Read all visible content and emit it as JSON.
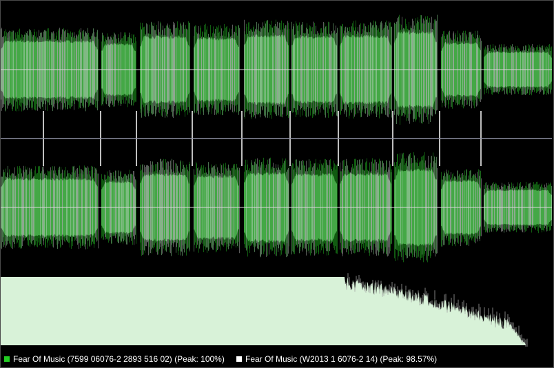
{
  "legend": [
    {
      "label": "Fear Of Music (7599 06076-2 2893 516 02) (Peak: 100%)",
      "color": "#22cc22"
    },
    {
      "label": "Fear Of Music (W2013 1 6076-2 14) (Peak: 98.57%)",
      "color": "#ffffff"
    }
  ],
  "tracks": [
    {
      "amplitude": 0.62
    },
    {
      "amplitude": 0.56
    },
    {
      "amplitude": 0.72
    },
    {
      "amplitude": 0.68
    },
    {
      "amplitude": 0.74
    },
    {
      "amplitude": 0.72
    },
    {
      "amplitude": 0.73
    },
    {
      "amplitude": 0.82
    },
    {
      "amplitude": 0.58
    },
    {
      "amplitude": 0.38
    }
  ],
  "colors": {
    "background": "#000000",
    "waveform_fill": "#7fbd83",
    "waveform_peak_a": "#1f9a1f",
    "waveform_peak_b": "#9a9a9a",
    "center_line": "#d8d8d8",
    "channel_divider": "#8d8fa1",
    "track_marker": "#ffffff",
    "histogram_fill": "#d8f2d8",
    "histogram_edge": "#a0a0a0"
  }
}
